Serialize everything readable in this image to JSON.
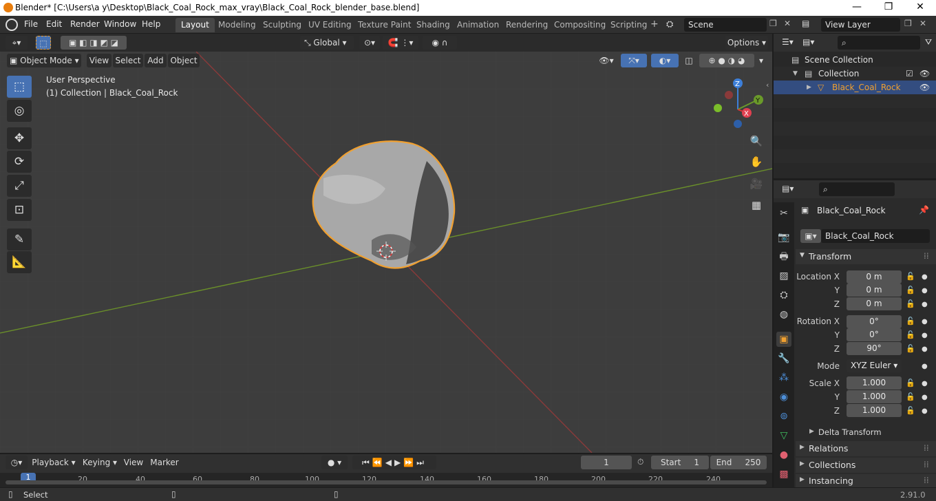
{
  "window": {
    "title": "Blender* [C:\\Users\\a y\\Desktop\\Black_Coal_Rock_max_vray\\Black_Coal_Rock_blender_base.blend]",
    "minimize": "—",
    "maximize": "❐",
    "close": "✕"
  },
  "menu": [
    "File",
    "Edit",
    "Render",
    "Window",
    "Help"
  ],
  "workspaces": [
    "Layout",
    "Modeling",
    "Sculpting",
    "UV Editing",
    "Texture Paint",
    "Shading",
    "Animation",
    "Rendering",
    "Compositing",
    "Scripting"
  ],
  "scene": {
    "name": "Scene",
    "view_layer": "View Layer"
  },
  "tool_header": {
    "orientation": "Global",
    "options": "Options"
  },
  "viewport": {
    "mode": "Object Mode",
    "menus": [
      "View",
      "Select",
      "Add",
      "Object"
    ],
    "overlay_title": "User Perspective",
    "overlay_sub": "(1) Collection | Black_Coal_Rock",
    "gizmo": {
      "z": "Z",
      "y": "Y",
      "x": "X"
    }
  },
  "outliner": {
    "root": "Scene Collection",
    "collection": "Collection",
    "object": "Black_Coal_Rock"
  },
  "properties": {
    "object_name": "Black_Coal_Rock",
    "mesh_name": "Black_Coal_Rock",
    "transform_header": "Transform",
    "location_x_label": "Location X",
    "rotation_x_label": "Rotation X",
    "scale_x_label": "Scale X",
    "y_label": "Y",
    "z_label": "Z",
    "mode_label": "Mode",
    "location": {
      "x": "0 m",
      "y": "0 m",
      "z": "0 m"
    },
    "rotation": {
      "x": "0°",
      "y": "0°",
      "z": "90°"
    },
    "rotation_mode": "XYZ Euler",
    "scale": {
      "x": "1.000",
      "y": "1.000",
      "z": "1.000"
    },
    "delta_transform": "Delta Transform",
    "relations": "Relations",
    "collections": "Collections",
    "instancing": "Instancing"
  },
  "timeline": {
    "menus": [
      "Playback",
      "Keying",
      "View",
      "Marker"
    ],
    "current_frame": "1",
    "start_label": "Start",
    "start": "1",
    "end_label": "End",
    "end": "250",
    "ruler": [
      "1",
      "20",
      "40",
      "60",
      "80",
      "100",
      "120",
      "140",
      "160",
      "180",
      "200",
      "220",
      "240"
    ]
  },
  "status": {
    "left": "Select",
    "version": "2.91.0"
  },
  "colors": {
    "accent": "#4772b3",
    "selection": "#f0a030",
    "x_axis": "#8b3a3a",
    "y_axis": "#6a8f2a"
  }
}
